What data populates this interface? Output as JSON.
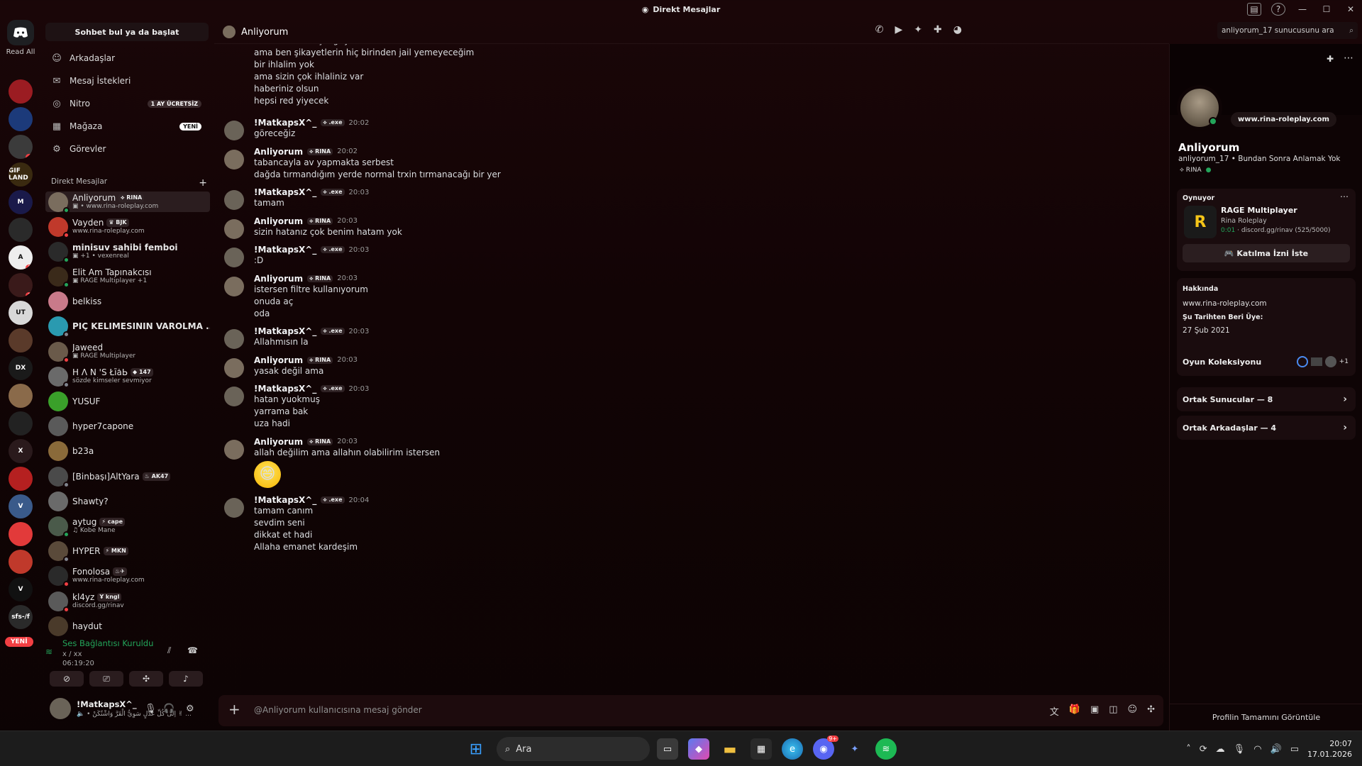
{
  "window": {
    "title": "Direkt Mesajlar"
  },
  "rail": {
    "read_all": "Read All",
    "new_label": "YENİ",
    "servers": [
      {
        "label": "",
        "color": "#9b1c22",
        "badge": ""
      },
      {
        "label": "",
        "color": "#1c3a7a",
        "badge": ""
      },
      {
        "label": "",
        "color": "#3b3b3b",
        "badge": "4"
      },
      {
        "label": "GIF LAND",
        "color": "#3a2a10",
        "badge": ""
      },
      {
        "label": "M",
        "color": "#1a1a4a",
        "badge": ""
      },
      {
        "label": "",
        "color": "#2a2a2a",
        "badge": ""
      },
      {
        "label": "A",
        "color": "#eeeeee",
        "badge": "2"
      },
      {
        "label": "",
        "color": "#3a1a1a",
        "badge": "1"
      },
      {
        "label": "UT",
        "color": "#d8d8d8",
        "badge": ""
      },
      {
        "label": "",
        "color": "#5a3a2a",
        "badge": ""
      },
      {
        "label": "DX",
        "color": "#1a1a1a",
        "badge": ""
      },
      {
        "label": "",
        "color": "#8a6a4a",
        "badge": ""
      },
      {
        "label": "",
        "color": "#222222",
        "badge": ""
      },
      {
        "label": "X",
        "color": "#2a1a1c",
        "badge": ""
      },
      {
        "label": "",
        "color": "#b52020",
        "badge": ""
      },
      {
        "label": "V",
        "color": "#3a5a8a",
        "badge": ""
      },
      {
        "label": "",
        "color": "#e23a3a",
        "badge": ""
      },
      {
        "label": "",
        "color": "#c0392b",
        "badge": ""
      },
      {
        "label": "V",
        "color": "#111111",
        "badge": ""
      },
      {
        "label": "sfs-/f",
        "color": "#2a2a2a",
        "badge": ""
      }
    ]
  },
  "dm_column": {
    "search": "Sohbet bul ya da başlat",
    "nav": [
      {
        "icon": "friends-icon",
        "glyph": "☺",
        "label": "Arkadaşlar",
        "tag": "",
        "tag_color": ""
      },
      {
        "icon": "mail-icon",
        "glyph": "✉",
        "label": "Mesaj İstekleri",
        "tag": "",
        "tag_color": ""
      },
      {
        "icon": "nitro-icon",
        "glyph": "◎",
        "label": "Nitro",
        "tag": "1 AY ÜCRETSİZ",
        "tag_color": "#3a2a2c"
      },
      {
        "icon": "shop-icon",
        "glyph": "▦",
        "label": "Mağaza",
        "tag": "YENİ",
        "tag_color": "#ffffff"
      },
      {
        "icon": "quests-icon",
        "glyph": "⚙",
        "label": "Görevler",
        "tag": "",
        "tag_color": ""
      }
    ],
    "dm_header": "Direkt Mesajlar",
    "add": "+",
    "dms": [
      {
        "name": "Anliyorum",
        "tag": "⟡ RINA",
        "sub": "▣ • www.rina-roleplay.com",
        "color": "#7a6d5e",
        "status": "#23a55a",
        "active": true
      },
      {
        "name": "Vayden",
        "tag": "♛ BJK",
        "sub": "www.rina-roleplay.com",
        "color": "#c0392b",
        "status": "#f23f43",
        "active": false
      },
      {
        "name": "minisuv sahibi femboi",
        "tag": "",
        "sub": "▣ +1 • vexenreal",
        "color": "#2a2a2a",
        "status": "#23a55a",
        "active": false
      },
      {
        "name": "Elit Am Tapınakcısı",
        "tag": "",
        "sub": "▣ RAGE Multiplayer +1",
        "color": "#3a2a1a",
        "status": "#23a55a",
        "active": false
      },
      {
        "name": "belkiss",
        "tag": "",
        "sub": "",
        "color": "#c97a8a",
        "status": "",
        "active": false
      },
      {
        "name": "PİÇ KELİMESİNİN VAROLMA ...",
        "tag": "",
        "sub": "",
        "color": "#2a9ab0",
        "status": "#80848e",
        "active": false
      },
      {
        "name": "Jaweed",
        "tag": "",
        "sub": "▣ RAGE Multiplayer",
        "color": "#6a5a4a",
        "status": "#f23f43",
        "active": false
      },
      {
        "name": "H Λ N 'S ŁīǡЬ",
        "tag": "◆ 147",
        "sub": "sözde kimseler sevmiyor",
        "color": "#6a6a6a",
        "status": "#80848e",
        "active": false
      },
      {
        "name": "YUSUF",
        "tag": "",
        "sub": "",
        "color": "#3aa02a",
        "status": "",
        "active": false
      },
      {
        "name": "hyper7capone",
        "tag": "",
        "sub": "",
        "color": "#5a5a5a",
        "status": "",
        "active": false
      },
      {
        "name": "b23a",
        "tag": "",
        "sub": "",
        "color": "#8a6a3a",
        "status": "",
        "active": false
      },
      {
        "name": "[Binbaşı]AltYara",
        "tag": "♨ AK47",
        "sub": "",
        "color": "#4a4a4a",
        "status": "#80848e",
        "active": false
      },
      {
        "name": "Shawty?",
        "tag": "",
        "sub": "",
        "color": "#6a6a6a",
        "status": "",
        "active": false
      },
      {
        "name": "aytug",
        "tag": "⚡ cape",
        "sub": "♫ Kobe Mane",
        "color": "#4a5a4a",
        "status": "#23a55a",
        "active": false
      },
      {
        "name": "HYPER",
        "tag": "⚡ MKN",
        "sub": "",
        "color": "#5a4a3a",
        "status": "#80848e",
        "active": false
      },
      {
        "name": "Fonolosa",
        "tag": "♨✈",
        "sub": "www.rina-roleplay.com",
        "color": "#2a2a2a",
        "status": "#f23f43",
        "active": false
      },
      {
        "name": "kl4yz",
        "tag": "Ұ kngl",
        "sub": "discord.gg/rinav",
        "color": "#5a5a5a",
        "status": "#f23f43",
        "active": false
      },
      {
        "name": "haydut",
        "tag": "",
        "sub": "",
        "color": "#4a3a2a",
        "status": "",
        "active": false
      }
    ]
  },
  "voice": {
    "title": "Ses Bağlantısı Kuruldu",
    "line1": "x / xx",
    "line2": "06:19:20"
  },
  "user": {
    "name": "!MatkapsX^_",
    "status": "🔈 • اِلى كُلِّ عَدْلٍ سَوِيُّ الْقَرَّ وَاشْتُكَنْ ✌ ..."
  },
  "chat": {
    "recipient": "Anliyorum",
    "search_placeholder": "anliyorum_17 sunucusunu ara",
    "composer_placeholder": "@Anliyorum kullanıcısına mesaj gönder"
  },
  "messages": [
    {
      "author": "",
      "badge": "",
      "time": "",
      "color": "",
      "lines": [
        "iki tarafında başı ağrıyabilir",
        "ama ben şikayetlerin hiç birinden jail yemeyeceğim",
        "bir ihlalim yok",
        "ama sizin çok ihlaliniz var",
        "haberiniz olsun",
        "hepsi red yiyecek"
      ]
    },
    {
      "author": "!MatkapsX^_",
      "badge": "⟡ .exe",
      "time": "20:02",
      "color": "#6a6358",
      "lines": [
        "göreceğiz"
      ]
    },
    {
      "author": "Anliyorum",
      "badge": "⟡ RINA",
      "time": "20:02",
      "color": "#7a6d5e",
      "lines": [
        "tabancayla av yapmakta serbest",
        "dağda tırmandığım yerde normal trxin tırmanacağı bir yer"
      ]
    },
    {
      "author": "!MatkapsX^_",
      "badge": "⟡ .exe",
      "time": "20:03",
      "color": "#6a6358",
      "lines": [
        "tamam"
      ]
    },
    {
      "author": "Anliyorum",
      "badge": "⟡ RINA",
      "time": "20:03",
      "color": "#7a6d5e",
      "lines": [
        "sizin hatanız çok benim hatam yok"
      ]
    },
    {
      "author": "!MatkapsX^_",
      "badge": "⟡ .exe",
      "time": "20:03",
      "color": "#6a6358",
      "lines": [
        ":D"
      ]
    },
    {
      "author": "Anliyorum",
      "badge": "⟡ RINA",
      "time": "20:03",
      "color": "#7a6d5e",
      "lines": [
        "istersen filtre kullanıyorum",
        "onuda aç",
        "oda"
      ]
    },
    {
      "author": "!MatkapsX^_",
      "badge": "⟡ .exe",
      "time": "20:03",
      "color": "#6a6358",
      "lines": [
        "Allahmısın la"
      ]
    },
    {
      "author": "Anliyorum",
      "badge": "⟡ RINA",
      "time": "20:03",
      "color": "#7a6d5e",
      "lines": [
        "yasak değil ama"
      ]
    },
    {
      "author": "!MatkapsX^_",
      "badge": "⟡ .exe",
      "time": "20:03",
      "color": "#6a6358",
      "lines": [
        "hatan yuokmuş",
        "yarrama bak",
        "uza hadi"
      ]
    },
    {
      "author": "Anliyorum",
      "badge": "⟡ RINA",
      "time": "20:03",
      "color": "#7a6d5e",
      "lines": [
        "allah değilim ama allahın olabilirim istersen"
      ],
      "emoji": "😄"
    },
    {
      "author": "!MatkapsX^_",
      "badge": "⟡ .exe",
      "time": "20:04",
      "color": "#6a6358",
      "lines": [
        "tamam canım",
        "sevdim seni",
        "dikkat et hadi",
        "Allaha emanet kardeşim"
      ]
    }
  ],
  "profile": {
    "website_bubble": "www.rina-roleplay.com",
    "display_name": "Anliyorum",
    "username_line": "anliyorum_17 • Bundan Sonra Anlamak Yok",
    "tag": "⟡ RINA",
    "activity": {
      "header": "Oynuyor",
      "game": "RAGE Multiplayer",
      "detail": "Rina Roleplay",
      "timer": "0:01",
      "server": "discord.gg/rinav (525/5000)",
      "join": "Katılma İzni İste"
    },
    "about": {
      "title": "Hakkında",
      "text": "www.rina-roleplay.com",
      "since_title": "Şu Tarihten Beri Üye:",
      "since": "27 Şub 2021"
    },
    "collection": {
      "title": "Oyun Koleksiyonu",
      "extra": "+1"
    },
    "mutual_servers": "Ortak Sunucular — 8",
    "mutual_friends": "Ortak Arkadaşlar — 4",
    "full_profile": "Profilin Tamamını Görüntüle"
  },
  "taskbar": {
    "search": "Ara",
    "discord_badge": "9+",
    "time": "20:07",
    "date": "17.01.2026"
  }
}
